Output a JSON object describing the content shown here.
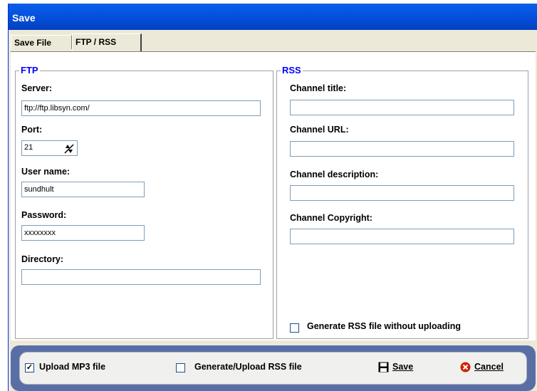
{
  "window": {
    "title": "Save"
  },
  "tabs": [
    {
      "label": "Save File"
    },
    {
      "label": "FTP / RSS"
    }
  ],
  "ftp": {
    "legend": "FTP",
    "server_label": "Server:",
    "server_value": "ftp://ftp.libsyn.com/",
    "port_label": "Port:",
    "port_value": "21",
    "username_label": "User name:",
    "username_value": "sundhult",
    "password_label": "Password:",
    "password_value": "xxxxxxxx",
    "directory_label": "Directory:",
    "directory_value": ""
  },
  "rss": {
    "legend": "RSS",
    "channel_title_label": "Channel title:",
    "channel_title_value": "",
    "channel_url_label": "Channel URL:",
    "channel_url_value": "",
    "channel_description_label": "Channel description:",
    "channel_description_value": "",
    "channel_copyright_label": "Channel Copyright:",
    "channel_copyright_value": "",
    "generate_without_upload_label": "Generate RSS file without uploading",
    "generate_without_upload_checked": false
  },
  "footer": {
    "upload_mp3_label": "Upload MP3 file",
    "upload_mp3_checked": true,
    "upload_rss_label": "Generate/Upload RSS file",
    "upload_rss_checked": false,
    "save_label": "Save",
    "cancel_label": "Cancel"
  },
  "colors": {
    "title_bar": "#0553e0",
    "legend_text": "#0000ff",
    "footer_frame": "#5a6ea6",
    "cancel_icon": "#cc2200"
  }
}
